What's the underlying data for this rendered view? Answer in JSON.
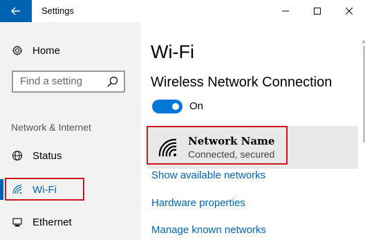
{
  "window": {
    "title": "Settings",
    "accent": "#0063b1"
  },
  "titlebar": {
    "back_icon": "arrow-left-icon",
    "minimize_icon": "minimize-icon",
    "maximize_icon": "maximize-icon",
    "close_icon": "close-icon"
  },
  "sidebar": {
    "home_label": "Home",
    "home_icon": "gear-icon",
    "search_placeholder": "Find a setting",
    "section_label": "Network & Internet",
    "items": [
      {
        "label": "Status",
        "icon": "globe-icon"
      },
      {
        "label": "Wi-Fi",
        "icon": "wifi-icon",
        "selected": true
      },
      {
        "label": "Ethernet",
        "icon": "monitor-icon"
      }
    ]
  },
  "main": {
    "title": "Wi-Fi",
    "connection_title": "Wireless Network Connection",
    "toggle_label": "On",
    "toggle_on": true,
    "network": {
      "name": "Network Name",
      "status": "Connected, secured",
      "icon": "wifi-signal-icon"
    },
    "links": [
      "Show available networks",
      "Hardware properties",
      "Manage known networks"
    ]
  },
  "highlight_color": "#d0121b"
}
